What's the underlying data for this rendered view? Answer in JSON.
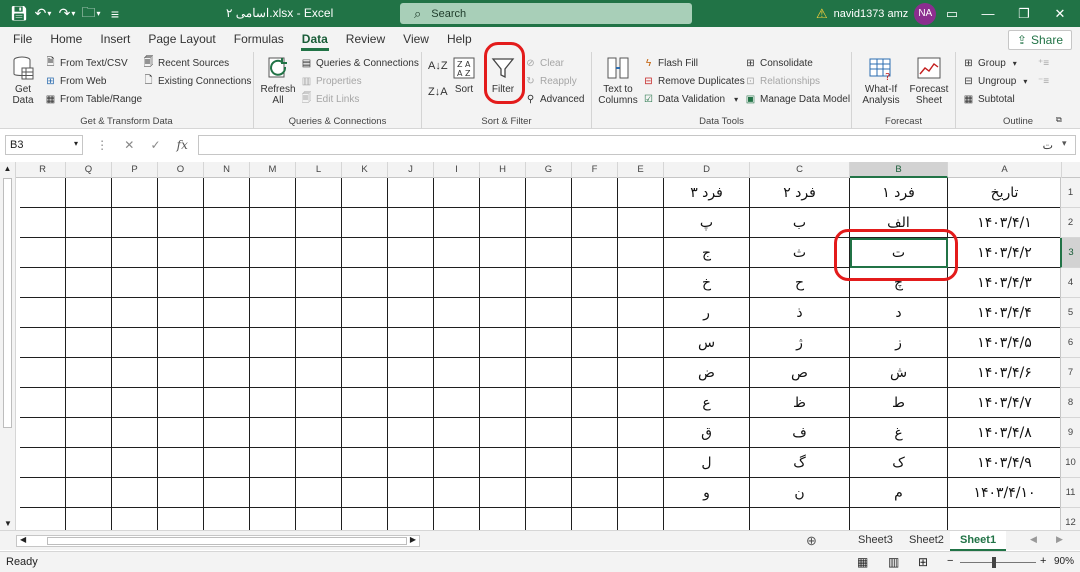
{
  "window": {
    "title": "اسامی ۲.xlsx  -  Excel",
    "search_placeholder": "Search",
    "user_name": "navid1373 amz",
    "user_initials": "NA"
  },
  "menu_tabs": [
    "File",
    "Home",
    "Insert",
    "Page Layout",
    "Formulas",
    "Data",
    "Review",
    "View",
    "Help"
  ],
  "active_tab": "Data",
  "share_label": "Share",
  "ribbon": {
    "get_transform": {
      "label": "Get & Transform Data",
      "get_data": "Get\nData",
      "from_text_csv": "From Text/CSV",
      "from_web": "From Web",
      "from_table": "From Table/Range",
      "recent_sources": "Recent Sources",
      "existing_connections": "Existing Connections"
    },
    "queries": {
      "label": "Queries & Connections",
      "refresh_all": "Refresh\nAll",
      "queries_connections": "Queries & Connections",
      "properties": "Properties",
      "edit_links": "Edit Links"
    },
    "sort_filter": {
      "label": "Sort & Filter",
      "sort": "Sort",
      "filter": "Filter",
      "clear": "Clear",
      "reapply": "Reapply",
      "advanced": "Advanced"
    },
    "data_tools": {
      "label": "Data Tools",
      "text_to_columns": "Text to\nColumns",
      "flash_fill": "Flash Fill",
      "remove_duplicates": "Remove Duplicates",
      "data_validation": "Data Validation",
      "consolidate": "Consolidate",
      "relationships": "Relationships",
      "manage_data_model": "Manage Data Model"
    },
    "forecast": {
      "label": "Forecast",
      "what_if": "What-If\nAnalysis",
      "forecast_sheet": "Forecast\nSheet"
    },
    "outline": {
      "label": "Outline",
      "group": "Group",
      "ungroup": "Ungroup",
      "subtotal": "Subtotal"
    }
  },
  "formula_bar": {
    "name_box": "B3",
    "formula": "ت"
  },
  "columns": [
    "R",
    "Q",
    "P",
    "O",
    "N",
    "M",
    "L",
    "K",
    "J",
    "I",
    "H",
    "G",
    "F",
    "E",
    "D",
    "C",
    "B",
    "A"
  ],
  "rows": [
    "1",
    "2",
    "3",
    "4",
    "5",
    "6",
    "7",
    "8",
    "9",
    "10",
    "11",
    "12"
  ],
  "table": [
    {
      "A": "تاریخ",
      "B": "فرد ۱",
      "C": "فرد ۲",
      "D": "فرد ۳"
    },
    {
      "A": "۱۴۰۳/۴/۱",
      "B": "الف",
      "C": "ب",
      "D": "پ"
    },
    {
      "A": "۱۴۰۳/۴/۲",
      "B": "ت",
      "C": "ث",
      "D": "ج"
    },
    {
      "A": "۱۴۰۳/۴/۳",
      "B": "چ",
      "C": "ح",
      "D": "خ"
    },
    {
      "A": "۱۴۰۳/۴/۴",
      "B": "د",
      "C": "ذ",
      "D": "ر"
    },
    {
      "A": "۱۴۰۳/۴/۵",
      "B": "ز",
      "C": "ژ",
      "D": "س"
    },
    {
      "A": "۱۴۰۳/۴/۶",
      "B": "ش",
      "C": "ص",
      "D": "ض"
    },
    {
      "A": "۱۴۰۳/۴/۷",
      "B": "ط",
      "C": "ظ",
      "D": "ع"
    },
    {
      "A": "۱۴۰۳/۴/۸",
      "B": "غ",
      "C": "ف",
      "D": "ق"
    },
    {
      "A": "۱۴۰۳/۴/۹",
      "B": "ک",
      "C": "گ",
      "D": "ل"
    },
    {
      "A": "۱۴۰۳/۴/۱۰",
      "B": "م",
      "C": "ن",
      "D": "و"
    }
  ],
  "selected_cell": "B3",
  "sheets": [
    "Sheet3",
    "Sheet2",
    "Sheet1"
  ],
  "active_sheet": "Sheet1",
  "status": {
    "text": "Ready",
    "zoom": "90%"
  },
  "colors": {
    "brand": "#217346",
    "annotation": "#e31b1b"
  }
}
